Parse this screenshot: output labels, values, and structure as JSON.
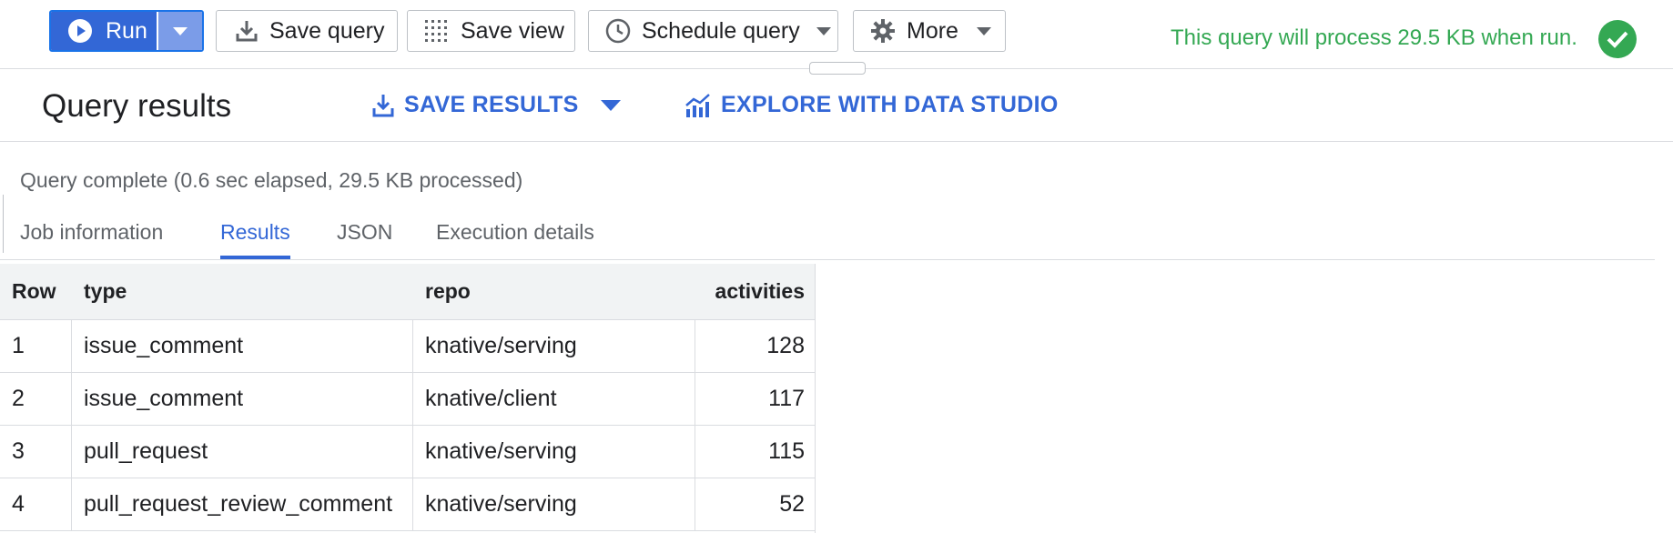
{
  "toolbar": {
    "run_label": "Run",
    "save_query_label": "Save query",
    "save_view_label": "Save view",
    "schedule_query_label": "Schedule query",
    "more_label": "More",
    "validator_message": "This query will process 29.5 KB when run."
  },
  "results": {
    "title": "Query results",
    "save_results_label": "SAVE RESULTS",
    "explore_label": "EXPLORE WITH DATA STUDIO",
    "status": "Query complete (0.6 sec elapsed, 29.5 KB processed)"
  },
  "tabs": [
    {
      "label": "Job information"
    },
    {
      "label": "Results"
    },
    {
      "label": "JSON"
    },
    {
      "label": "Execution details"
    }
  ],
  "table": {
    "headers": [
      "Row",
      "type",
      "repo",
      "activities"
    ],
    "rows": [
      {
        "row": "1",
        "type": "issue_comment",
        "repo": "knative/serving",
        "activities": "128"
      },
      {
        "row": "2",
        "type": "issue_comment",
        "repo": "knative/client",
        "activities": "117"
      },
      {
        "row": "3",
        "type": "pull_request",
        "repo": "knative/serving",
        "activities": "115"
      },
      {
        "row": "4",
        "type": "pull_request_review_comment",
        "repo": "knative/serving",
        "activities": "52"
      }
    ]
  },
  "colors": {
    "accent": "#3367d6",
    "success": "#34a853"
  },
  "icons": [
    "play-icon",
    "download-icon",
    "grid-icon",
    "clock-icon",
    "gear-icon",
    "check-icon",
    "chart-icon"
  ]
}
